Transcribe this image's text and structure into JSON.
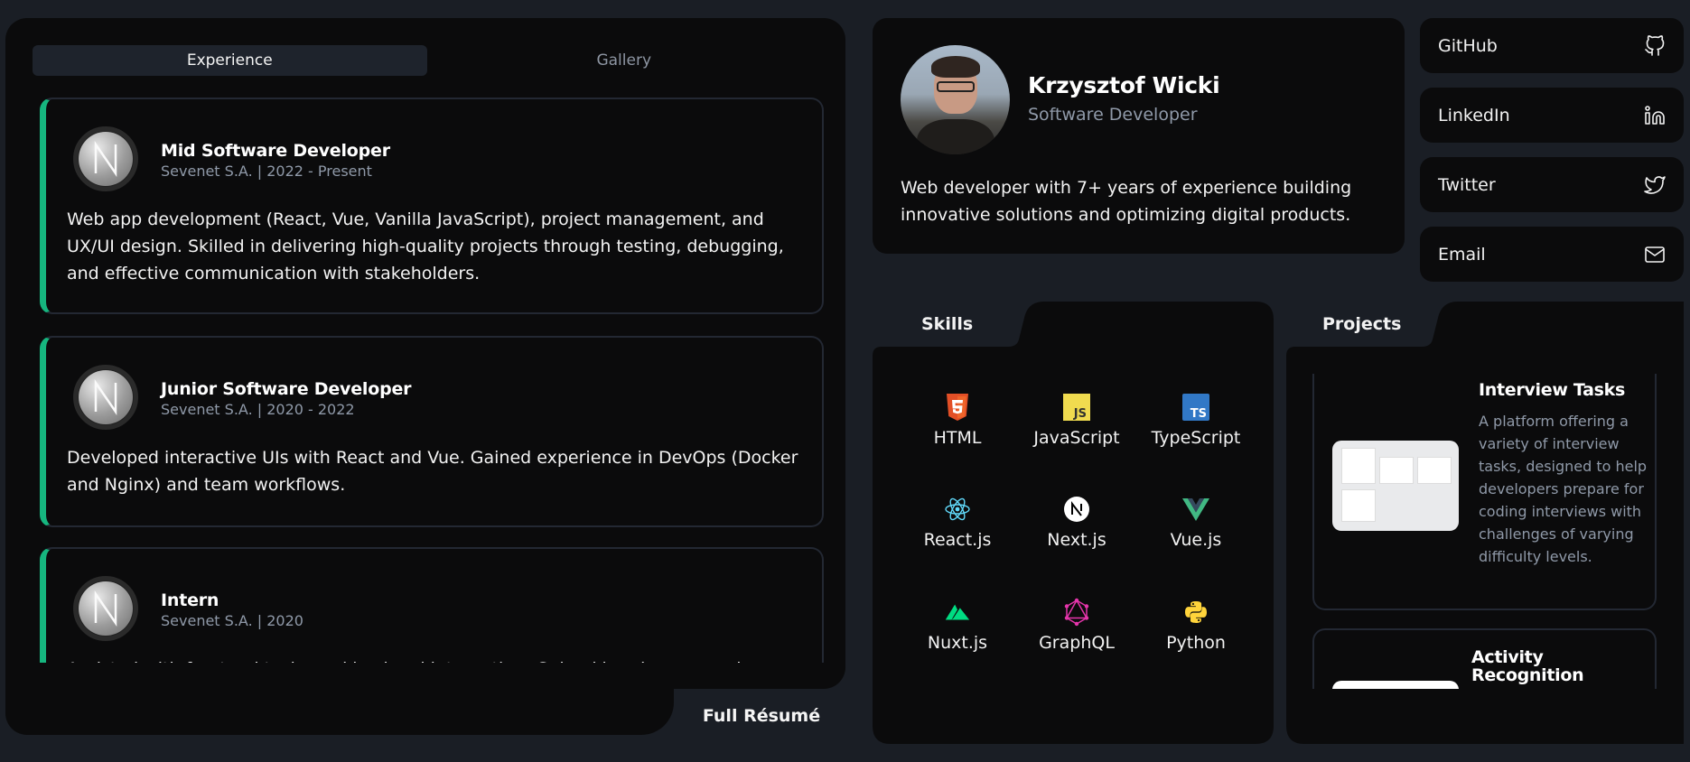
{
  "tabs": {
    "experience": "Experience",
    "gallery": "Gallery"
  },
  "experience": [
    {
      "title": "Mid Software Developer",
      "meta": "Sevenet S.A. | 2022 - Present",
      "description": "Web app development (React, Vue, Vanilla JavaScript), project management, and UX/UI design. Skilled in delivering high-quality projects through testing, debugging, and effective communication with stakeholders."
    },
    {
      "title": "Junior Software Developer",
      "meta": "Sevenet S.A. | 2020 - 2022",
      "description": "Developed interactive UIs with React and Vue. Gained experience in DevOps (Docker and Nginx) and team workflows."
    },
    {
      "title": "Intern",
      "meta": "Sevenet S.A. | 2020",
      "description": "Assisted with frontend tasks and backend integration. Gained hands-on experience with..."
    }
  ],
  "resume_button": "Full Résumé",
  "profile": {
    "name": "Krzysztof Wicki",
    "role": "Software Developer",
    "bio": "Web developer with 7+ years of experience building innovative solutions and optimizing digital products."
  },
  "social": [
    {
      "label": "GitHub",
      "icon": "github-icon"
    },
    {
      "label": "LinkedIn",
      "icon": "linkedin-icon"
    },
    {
      "label": "Twitter",
      "icon": "twitter-icon"
    },
    {
      "label": "Email",
      "icon": "mail-icon"
    }
  ],
  "skills": {
    "tab_label": "Skills",
    "items": [
      {
        "name": "HTML",
        "icon": "html5-icon",
        "color": "#e34f26"
      },
      {
        "name": "JavaScript",
        "icon": "javascript-icon",
        "color": "#f0db4f"
      },
      {
        "name": "TypeScript",
        "icon": "typescript-icon",
        "color": "#3178c6"
      },
      {
        "name": "React.js",
        "icon": "react-icon",
        "color": "#61dafb"
      },
      {
        "name": "Next.js",
        "icon": "nextjs-icon",
        "color": "#ffffff"
      },
      {
        "name": "Vue.js",
        "icon": "vue-icon",
        "color": "#41b883"
      },
      {
        "name": "Nuxt.js",
        "icon": "nuxt-icon",
        "color": "#00dc82"
      },
      {
        "name": "GraphQL",
        "icon": "graphql-icon",
        "color": "#e535ab"
      },
      {
        "name": "Python",
        "icon": "python-icon",
        "color": "#ffd43b"
      }
    ]
  },
  "projects": {
    "tab_label": "Projects",
    "items": [
      {
        "title": "Interview Tasks",
        "description": "A platform offering a variety of interview tasks, designed to help developers prepare for coding interviews with challenges of varying difficulty levels."
      },
      {
        "title": "Activity Recognition",
        "description": ""
      }
    ]
  },
  "colors": {
    "background": "#1a1e25",
    "card": "#0b0b0c",
    "accent": "#16b67f",
    "muted_text": "#8f99a8"
  }
}
